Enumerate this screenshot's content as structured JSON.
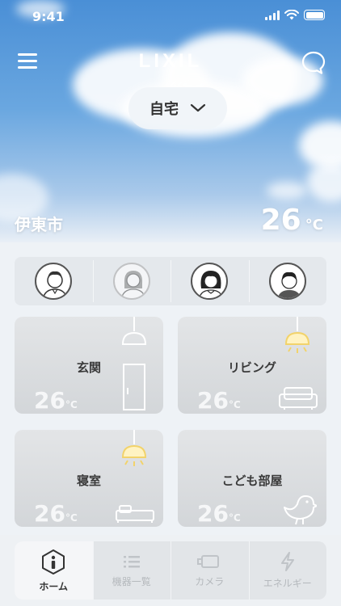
{
  "status_bar": {
    "time": "9:41"
  },
  "header": {
    "logo": "LIXIL",
    "location_label": "自宅"
  },
  "weather": {
    "city": "伊東市",
    "temperature": "26",
    "unit": "°C"
  },
  "members": [
    {
      "name": "member-1",
      "active": true
    },
    {
      "name": "member-2",
      "active": false
    },
    {
      "name": "member-3",
      "active": true
    },
    {
      "name": "member-4",
      "active": true
    }
  ],
  "rooms": [
    {
      "name": "玄関",
      "temperature": "26",
      "unit": "°C",
      "light_on": false,
      "icon": "door-icon"
    },
    {
      "name": "リビング",
      "temperature": "26",
      "unit": "°C",
      "light_on": true,
      "icon": "sofa-icon"
    },
    {
      "name": "寝室",
      "temperature": "26",
      "unit": "°C",
      "light_on": true,
      "icon": "bed-icon"
    },
    {
      "name": "こども部屋",
      "temperature": "26",
      "unit": "°C",
      "light_on": false,
      "icon": "bird-icon"
    }
  ],
  "nav": {
    "tabs": [
      {
        "label": "ホーム",
        "icon": "home-info-icon",
        "active": true
      },
      {
        "label": "機器一覧",
        "icon": "list-icon",
        "active": false
      },
      {
        "label": "カメラ",
        "icon": "camera-icon",
        "active": false
      },
      {
        "label": "エネルギー",
        "icon": "lightning-icon",
        "active": false
      }
    ]
  },
  "colors": {
    "lamp_on": "#f2d36b",
    "lamp_off": "#ffffff",
    "text_dark": "#333333"
  }
}
